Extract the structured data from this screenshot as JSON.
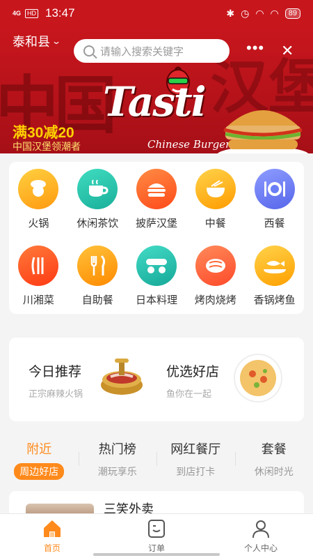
{
  "status_bar": {
    "signal": "4G",
    "hd": "HD",
    "time": "13:47",
    "battery": "89"
  },
  "header": {
    "city": "泰和县",
    "search_placeholder": "请输入搜索关键字"
  },
  "banner": {
    "promo": "满30减20",
    "promo_sub": "中国汉堡领潮者",
    "brand": "Tasti",
    "brand_sub": "Chinese Burger"
  },
  "categories": [
    {
      "label": "火锅",
      "icon": "hotpot-chef-icon",
      "color": "#ffae1f"
    },
    {
      "label": "休闲茶饮",
      "icon": "teacup-icon",
      "color": "#2ec4a6"
    },
    {
      "label": "披萨汉堡",
      "icon": "burger-icon",
      "color": "#ff6a2b"
    },
    {
      "label": "中餐",
      "icon": "noodle-bowl-icon",
      "color": "#ffb300"
    },
    {
      "label": "西餐",
      "icon": "plate-cutlery-icon",
      "color": "#6a7ef5"
    },
    {
      "label": "川湘菜",
      "icon": "chili-icon",
      "color": "#ff5a1f"
    },
    {
      "label": "自助餐",
      "icon": "fork-knife-icon",
      "color": "#ff9f0a"
    },
    {
      "label": "日本料理",
      "icon": "sushi-icon",
      "color": "#26c2b0"
    },
    {
      "label": "烤肉烧烤",
      "icon": "bbq-meat-icon",
      "color": "#ff6b3b"
    },
    {
      "label": "香锅烤鱼",
      "icon": "fish-icon",
      "color": "#ffb300"
    }
  ],
  "recommend": [
    {
      "title": "今日推荐",
      "sub": "正宗麻辣火锅"
    },
    {
      "title": "优选好店",
      "sub": "鱼你在一起"
    }
  ],
  "tabs": [
    {
      "title": "附近",
      "sub": "周边好店"
    },
    {
      "title": "热门榜",
      "sub": "潮玩享乐"
    },
    {
      "title": "网红餐厅",
      "sub": "到店打卡"
    },
    {
      "title": "套餐",
      "sub": "休闲时光"
    }
  ],
  "list_preview": {
    "name": "三笑外卖"
  },
  "bottom_nav": [
    {
      "label": "首页",
      "icon": "home-icon"
    },
    {
      "label": "订单",
      "icon": "order-icon"
    },
    {
      "label": "个人中心",
      "icon": "profile-icon"
    }
  ],
  "colors": {
    "brand_red": "#c8161d",
    "accent_orange": "#ff8a1c"
  }
}
